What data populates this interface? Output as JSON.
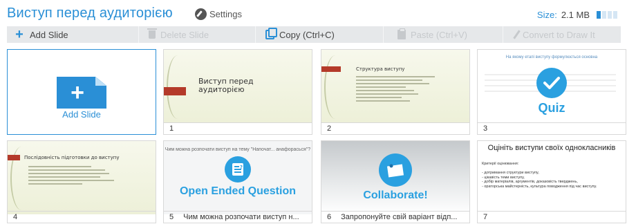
{
  "header": {
    "title": "Виступ перед аудиторією",
    "settings_label": "Settings",
    "size_label": "Size:",
    "size_value": "2.1 MB",
    "size_fill_fraction": 0.25
  },
  "toolbar": {
    "add_slide": "Add Slide",
    "delete_slide": "Delete Slide",
    "copy": "Copy (Ctrl+C)",
    "paste": "Paste (Ctrl+V)",
    "convert": "Convert to Draw It"
  },
  "add_tile": {
    "label": "Add Slide"
  },
  "slides": [
    {
      "number": "1",
      "caption": "",
      "title": "Виступ перед аудиторією",
      "subtitle": "",
      "type": "title"
    },
    {
      "number": "2",
      "caption": "",
      "title": "Структура виступу",
      "type": "content"
    },
    {
      "number": "3",
      "caption": "",
      "heading": "На якому етапі виступу формулюється основна",
      "label": "Quiz",
      "type": "quiz"
    },
    {
      "number": "4",
      "caption": "",
      "title": "Послідовність підготовки до виступу",
      "type": "content"
    },
    {
      "number": "5",
      "caption": "Чим можна розпочати виступ н...",
      "heading": "Чим можна розпочати виступ на тему \"Напочат... анафорасься\"?",
      "label": "Open Ended Question",
      "type": "open-ended"
    },
    {
      "number": "6",
      "caption": "Запропонуйте свій варіант відп...",
      "label": "Collaborate!",
      "type": "collaborate"
    },
    {
      "number": "7",
      "caption": "",
      "title": "Оцініть виступи своїх однокласників",
      "body": "Критерії оцінювання:\n\n- дотримання структури виступу,\n- цікавість теми виступу,\n- добір матеріалів, аргументів, доказовість тверджень,\n- ораторська майстерність, культура поводження під час виступу.",
      "type": "text"
    }
  ],
  "colors": {
    "accent": "#2a8fd6",
    "slide_red": "#b43a2a",
    "app_blue": "#2aa0e0"
  }
}
